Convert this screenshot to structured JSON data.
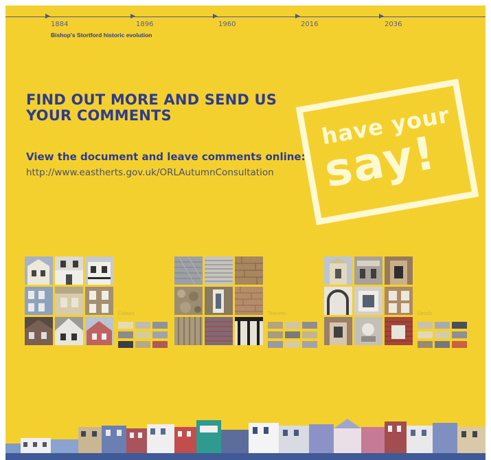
{
  "timeline": {
    "years": [
      "1884",
      "1896",
      "1960",
      "2016",
      "2036"
    ],
    "caption": "Bishop's Stortford historic evolution"
  },
  "callout": {
    "headline": "FIND OUT MORE AND SEND US YOUR COMMENTS",
    "subheading": "View the document and leave comments online:",
    "url": "http://www.eastherts.gov.uk/ORLAutumnConsultation"
  },
  "stamp": {
    "line1": "have your",
    "line2": "say!"
  },
  "groups": [
    {
      "label": "Colours",
      "swatches": [
        "#e6dbb3",
        "#bfbcaf",
        "#8e949a",
        "#8c8c8c",
        "#d6cc9a",
        "#9fa4aa",
        "#3d3f47",
        "#b5aa84",
        "#b05a58"
      ]
    },
    {
      "label": "Textures",
      "swatches": [
        "#b4a57c",
        "#d1c6a1",
        "#8f8f8f",
        "#a89c7e",
        "#787a80",
        "#c2b48c",
        "#9b9aa0",
        "#d7c9a2",
        "#a3a3a6"
      ]
    },
    {
      "label": "Details",
      "swatches": [
        "#c9c2a9",
        "#a9aab0",
        "#4c4f57",
        "#e3d9b6",
        "#d4cca9",
        "#8f8f94",
        "#9a8a6e",
        "#75777d",
        "#c8623f"
      ]
    }
  ],
  "colors": {
    "background": "#f4d02f",
    "headline": "#2e3c8c",
    "link": "#4a4f69",
    "stamp": "#fffce2"
  }
}
